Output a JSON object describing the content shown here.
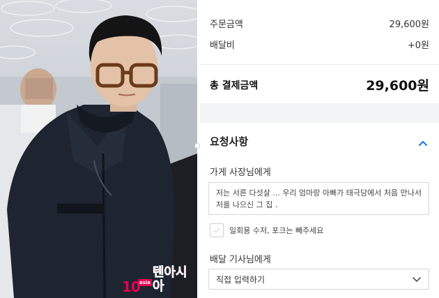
{
  "photo": {
    "alt": "photo-of-man-in-dark-puffer-jacket-with-glasses",
    "watermark": {
      "number": "10",
      "badge": "asia",
      "text": "텐아시아"
    },
    "colors": {
      "watermark": "#e4004f",
      "jacket": "#1e2430"
    }
  },
  "order": {
    "order_amount_label": "주문금액",
    "order_amount_value": "29,600원",
    "delivery_fee_label": "배달비",
    "delivery_fee_value": "+0원",
    "total_label": "총 결제금액",
    "total_value": "29,600원"
  },
  "requests": {
    "title": "요청사항",
    "owner_label": "가게 사장님에게",
    "owner_message": "저는 서른 다섯살 ... 우리 엄마랑 아빠가 태극당에서 처음 만나서 저를 나으신 그 집 .",
    "utensils_label": "일회용 수저, 포크는 빼주세요",
    "utensils_checked": false,
    "rider_label": "배달 기사님에게",
    "rider_select_value": "직접 입력하기"
  },
  "icons": {
    "collapse": "chevron-up-icon",
    "dropdown": "chevron-down-icon",
    "checkbox": "check-icon"
  },
  "colors": {
    "accent": "#1a73e8",
    "band": "#f3f4f6",
    "border": "#d6d6d6"
  }
}
